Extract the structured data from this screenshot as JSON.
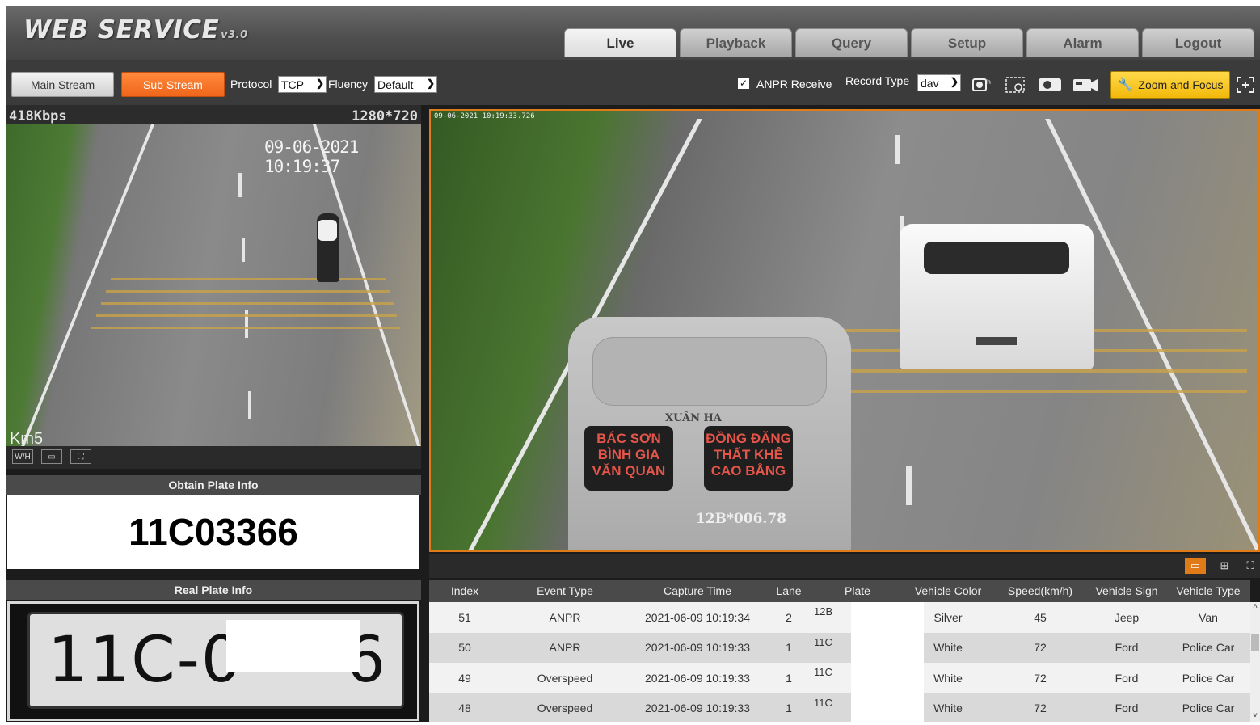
{
  "header": {
    "logo": "WEB SERVICE",
    "version": "v3.0",
    "tabs": [
      "Live",
      "Playback",
      "Query",
      "Setup",
      "Alarm",
      "Logout"
    ],
    "active_tab": "Live"
  },
  "toolbar": {
    "main_stream": "Main Stream",
    "sub_stream": "Sub Stream",
    "protocol_label": "Protocol",
    "protocol_value": "TCP",
    "fluency_label": "Fluency",
    "fluency_value": "Default",
    "anpr_label": "ANPR Receive",
    "anpr_checked": true,
    "record_type_label": "Record Type",
    "record_type_value": "dav",
    "zoom_focus": "Zoom and Focus"
  },
  "left_video": {
    "bitrate": "418Kbps",
    "resolution": "1280*720",
    "timestamp": "09-06-2021 10:19:37",
    "overlay_text": "Km5"
  },
  "main_video": {
    "timestamp": "09-06-2021 10:19:33.726",
    "van_window_left": "BÁC SƠN\nBÌNH GIA\nVĂN QUAN",
    "van_window_right": "ĐỒNG ĐĂNG\nTHẤT KHÊ\nCAO BẰNG",
    "van_brand": "XUÂN HA",
    "van_plate": "12B*006.78"
  },
  "plate_info": {
    "obtain_header": "Obtain Plate Info",
    "obtain_value": "11C03366",
    "real_header": "Real Plate Info",
    "real_plate_visible": "11C-0",
    "real_plate_end": "6"
  },
  "table": {
    "columns": [
      "Index",
      "Event Type",
      "Capture Time",
      "Lane",
      "Plate",
      "Vehicle Color",
      "Speed(km/h)",
      "Vehicle Sign",
      "Vehicle Type"
    ],
    "rows": [
      {
        "index": "51",
        "event": "ANPR",
        "time": "2021-06-09 10:19:34",
        "lane": "2",
        "plate": "12B",
        "color": "Silver",
        "speed": "45",
        "sign": "Jeep",
        "type": "Van"
      },
      {
        "index": "50",
        "event": "ANPR",
        "time": "2021-06-09 10:19:33",
        "lane": "1",
        "plate": "11C",
        "color": "White",
        "speed": "72",
        "sign": "Ford",
        "type": "Police Car"
      },
      {
        "index": "49",
        "event": "Overspeed",
        "time": "2021-06-09 10:19:33",
        "lane": "1",
        "plate": "11C",
        "color": "White",
        "speed": "72",
        "sign": "Ford",
        "type": "Police Car"
      },
      {
        "index": "48",
        "event": "Overspeed",
        "time": "2021-06-09 10:19:33",
        "lane": "1",
        "plate": "11C",
        "color": "White",
        "speed": "72",
        "sign": "Ford",
        "type": "Police Car"
      }
    ]
  },
  "colors": {
    "accent_orange": "#f0661a",
    "zoom_yellow": "#f2b90a",
    "video_border": "#e07b1a"
  },
  "icons": [
    "snapshot-icon",
    "region-zoom-icon",
    "record-icon",
    "camera-icon",
    "wrench-icon",
    "fullscreen-icon"
  ]
}
